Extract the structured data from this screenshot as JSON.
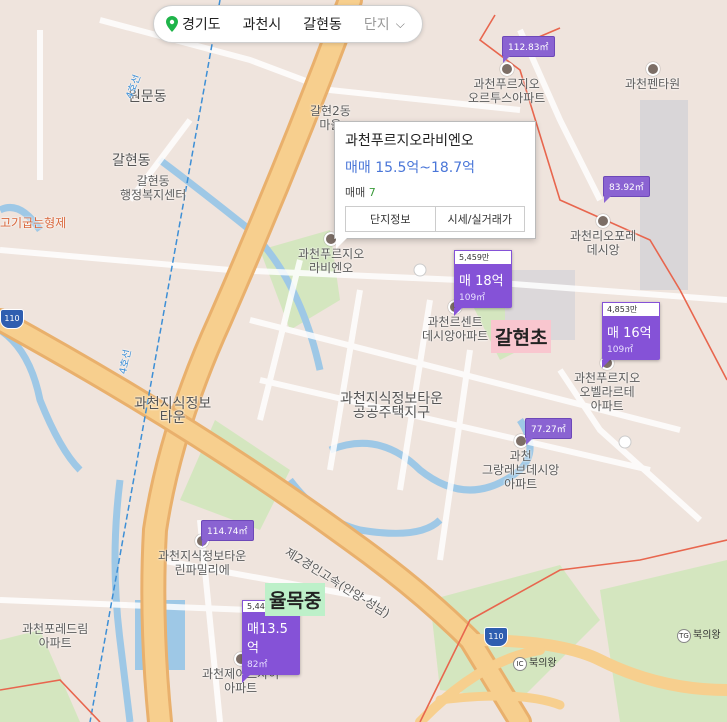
{
  "breadcrumb": {
    "province": "경기도",
    "city": "과천시",
    "dong": "갈현동",
    "type": "단지"
  },
  "popup": {
    "name": "과천푸르지오라비엔오",
    "price": "매매 15.5억~18.7억",
    "count_label": "매매",
    "count_value": "7",
    "button_info": "단지정보",
    "button_price": "시세/실거래가"
  },
  "labels": {
    "wonmun": "원문동",
    "galhyeon": "갈현동",
    "galhyeon_center": [
      "갈현동",
      "행정복지센터"
    ],
    "galhyeon2": [
      "갈현2동",
      "마을"
    ],
    "gogi": "고기굽는형제",
    "orthus": [
      "과천푸르지오",
      "오르투스아파트"
    ],
    "pentower": "과천펜타원",
    "rabieno": [
      "과천푸르지오",
      "라비엔오"
    ],
    "riopore": [
      "과천리오포레",
      "데시앙"
    ],
    "centre": [
      "과천르센트",
      "데시앙아파트"
    ],
    "orbellarte": [
      "과천푸르지오",
      "오벨라르테",
      "아파트"
    ],
    "jisik_town": [
      "과천지식정보",
      "타운"
    ],
    "jisik_public": [
      "과천지식정보타운",
      "공공주택지구"
    ],
    "grandreve": [
      "과천",
      "그랑레브데시앙",
      "아파트"
    ],
    "expressway": "제2경인고속(안양-성남)",
    "lean_family": [
      "과천지식정보타운",
      "린파밀리에"
    ],
    "forestrim": [
      "과천포레드림",
      "아파트"
    ],
    "xi": [
      "과천제이드자이",
      "아파트"
    ],
    "bukuiwang": "북의왕",
    "tg_bukuiwang": "북의왕",
    "rail": "4호선"
  },
  "markers_small": [
    {
      "id": "orthus",
      "value": "112.83㎡"
    },
    {
      "id": "riopore",
      "value": "83.92㎡"
    },
    {
      "id": "grandreve",
      "value": "77.27㎡"
    },
    {
      "id": "lean",
      "value": "114.74㎡"
    }
  ],
  "markers_big": [
    {
      "id": "centre",
      "top": "5,459만",
      "price": "매 18억",
      "area": "109㎡"
    },
    {
      "id": "orbellarte",
      "top": "4,853만",
      "price": "매 16억",
      "area": "109㎡"
    },
    {
      "id": "xi",
      "top": "5,44",
      "price": "매13.5억",
      "area": "82㎡"
    }
  ],
  "schools": {
    "galhyeon_elem": "갈현초",
    "yulmok_mid": "율목중"
  },
  "shields": {
    "r110_left": "110",
    "r110_bottom": "110"
  },
  "ic_labels": {
    "ic": "IC",
    "tg": "TG"
  },
  "colors": {
    "background": "#efe4dd",
    "road_major": "#f5c583",
    "water": "#9ec8e6",
    "green": "#cfe3b8",
    "boundary": "#e8664e",
    "marker": "#8552d7",
    "elem_school_bg": "#f9c6cf",
    "mid_school_bg": "#bdf0c9"
  }
}
